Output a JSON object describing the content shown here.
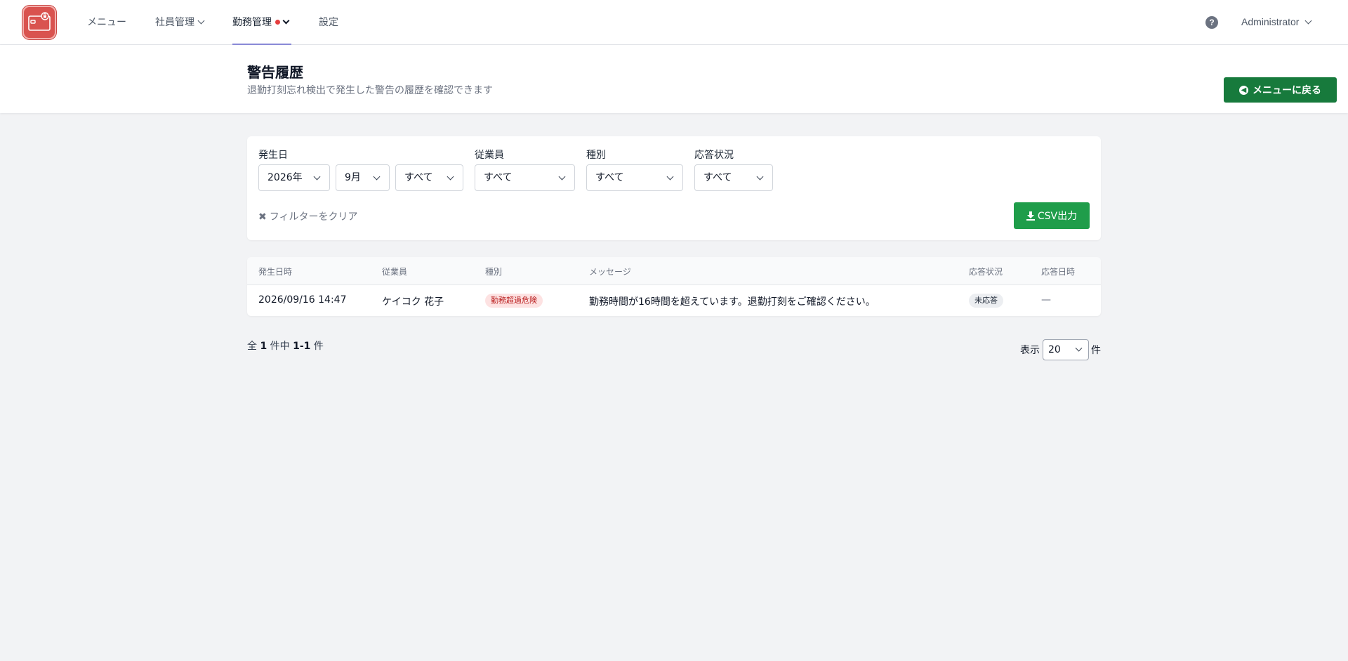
{
  "nav": {
    "items": [
      {
        "label": "メニュー"
      },
      {
        "label": "社員管理"
      },
      {
        "label": "勤務管理"
      },
      {
        "label": "設定"
      }
    ],
    "user": "Administrator",
    "help_symbol": "?"
  },
  "header": {
    "title": "警告履歴",
    "subtitle": "退勤打刻忘れ検出で発生した警告の履歴を確認できます",
    "back_label": "メニューに戻る"
  },
  "filters": {
    "date_label": "発生日",
    "year": "2026年",
    "month": "9月",
    "day": "すべて",
    "employee_label": "従業員",
    "employee": "すべて",
    "type_label": "種別",
    "type": "すべて",
    "status_label": "応答状況",
    "status": "すべて",
    "clear_label": "フィルターをクリア",
    "csv_label": "CSV出力"
  },
  "table": {
    "headers": [
      "発生日時",
      "従業員",
      "種別",
      "メッセージ",
      "応答状況",
      "応答日時"
    ],
    "rows": [
      {
        "datetime": "2026/09/16 14:47",
        "employee": "ケイコク 花子",
        "type": "勤務超過危険",
        "message": "勤務時間が16時間を超えています。退勤打刻をご確認ください。",
        "status": "未応答",
        "responded_at": "—"
      }
    ]
  },
  "footer": {
    "total_prefix": "全",
    "total": "1",
    "mid": "件中",
    "range": "1-1",
    "suffix": "件",
    "perpage_label": "表示",
    "perpage_value": "20",
    "perpage_suffix": "件"
  },
  "colors": {
    "primary_green": "#177a3c",
    "csv_green": "#1f9d4a",
    "danger_badge": "#fde2e2",
    "logo_red": "#d9534f"
  }
}
